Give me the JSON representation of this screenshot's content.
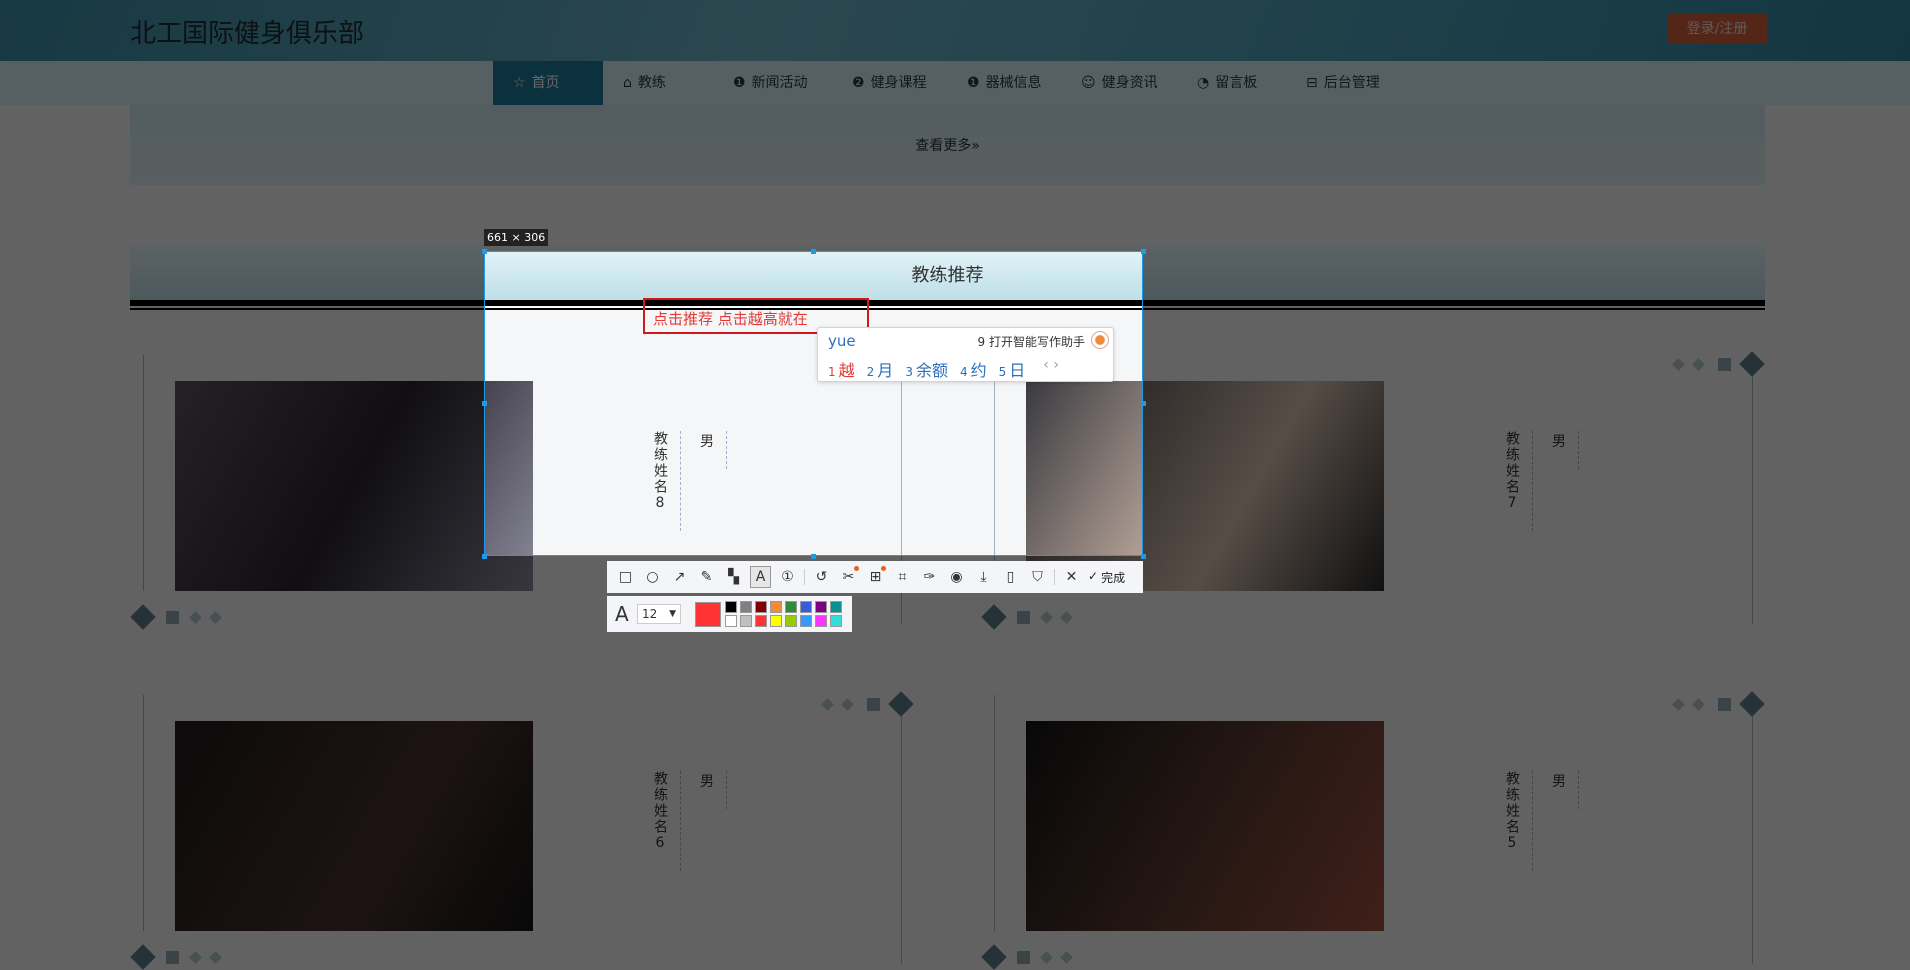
{
  "header": {
    "title": "北工国际健身俱乐部",
    "login_label": "登录/注册"
  },
  "nav": {
    "items": [
      {
        "label": "首页",
        "icon": "star-icon",
        "glyph": "☆",
        "active": true
      },
      {
        "label": "教练",
        "icon": "bag-icon",
        "glyph": "⌂"
      },
      {
        "label": "新闻活动",
        "icon": "info-icon",
        "glyph": "❶"
      },
      {
        "label": "健身课程",
        "icon": "question-icon",
        "glyph": "❷"
      },
      {
        "label": "器械信息",
        "icon": "info-icon",
        "glyph": "❶"
      },
      {
        "label": "健身资讯",
        "icon": "smile-icon",
        "glyph": "☺"
      },
      {
        "label": "留言板",
        "icon": "check-circle-icon",
        "glyph": "◔"
      },
      {
        "label": "后台管理",
        "icon": "briefcase-icon",
        "glyph": "⊟"
      }
    ]
  },
  "banner": {
    "more_label": "查看更多»"
  },
  "section": {
    "title": "教练推荐"
  },
  "coaches": [
    {
      "name": "教练姓名8",
      "gender": "男"
    },
    {
      "name": "教练姓名7",
      "gender": "男"
    },
    {
      "name": "教练姓名6",
      "gender": "男"
    },
    {
      "name": "教练姓名5",
      "gender": "男"
    }
  ],
  "screenshot_tool": {
    "size_label": "661 × 306",
    "annotation_text": "点击推荐 点击越高就在",
    "font_size": "12",
    "current_color": "#ff3333",
    "done_label": "完成",
    "palette": [
      "#000000",
      "#808080",
      "#800000",
      "#f08c3c",
      "#2e8b3a",
      "#3a5bd9",
      "#800080",
      "#0d9090",
      "#ffffff",
      "#c0c0c0",
      "#ff3333",
      "#ffff00",
      "#99cc00",
      "#3399ff",
      "#ff33ff",
      "#33dddd"
    ],
    "tools": [
      "rectangle-icon",
      "ellipse-icon",
      "arrow-icon",
      "pencil-icon",
      "mosaic-icon",
      "text-icon",
      "number-icon",
      "undo-icon",
      "cut-icon",
      "ocr-icon",
      "translate-icon",
      "pin-icon",
      "record-icon",
      "download-icon",
      "phone-icon",
      "bookmark-icon",
      "close-icon"
    ]
  },
  "ime": {
    "input": "yue",
    "assistant_label": "9 打开智能写作助手",
    "candidates": [
      {
        "n": "1",
        "t": "越"
      },
      {
        "n": "2",
        "t": "月"
      },
      {
        "n": "3",
        "t": "余额"
      },
      {
        "n": "4",
        "t": "约"
      },
      {
        "n": "5",
        "t": "日"
      }
    ],
    "nav": "‹ ›"
  }
}
